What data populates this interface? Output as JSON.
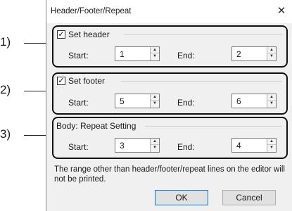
{
  "callouts": [
    "1)",
    "2)",
    "3)"
  ],
  "window": {
    "title": "Header/Footer/Repeat",
    "close_glyph": "✕"
  },
  "header": {
    "checkbox_label": "Set header",
    "checked": true,
    "start_label": "Start:",
    "start_value": "1",
    "end_label": "End:",
    "end_value": "2"
  },
  "footer": {
    "checkbox_label": "Set footer",
    "checked": true,
    "start_label": "Start:",
    "start_value": "5",
    "end_label": "End:",
    "end_value": "6"
  },
  "body": {
    "group_label": "Body: Repeat Setting",
    "start_label": "Start:",
    "start_value": "3",
    "end_label": "End:",
    "end_value": "4"
  },
  "note": "The range other than header/footer/repeat lines on the editor will not be printed.",
  "buttons": {
    "ok": "OK",
    "cancel": "Cancel"
  },
  "icons": {
    "check": "✓",
    "spin_up": "▲",
    "spin_down": "▼"
  }
}
